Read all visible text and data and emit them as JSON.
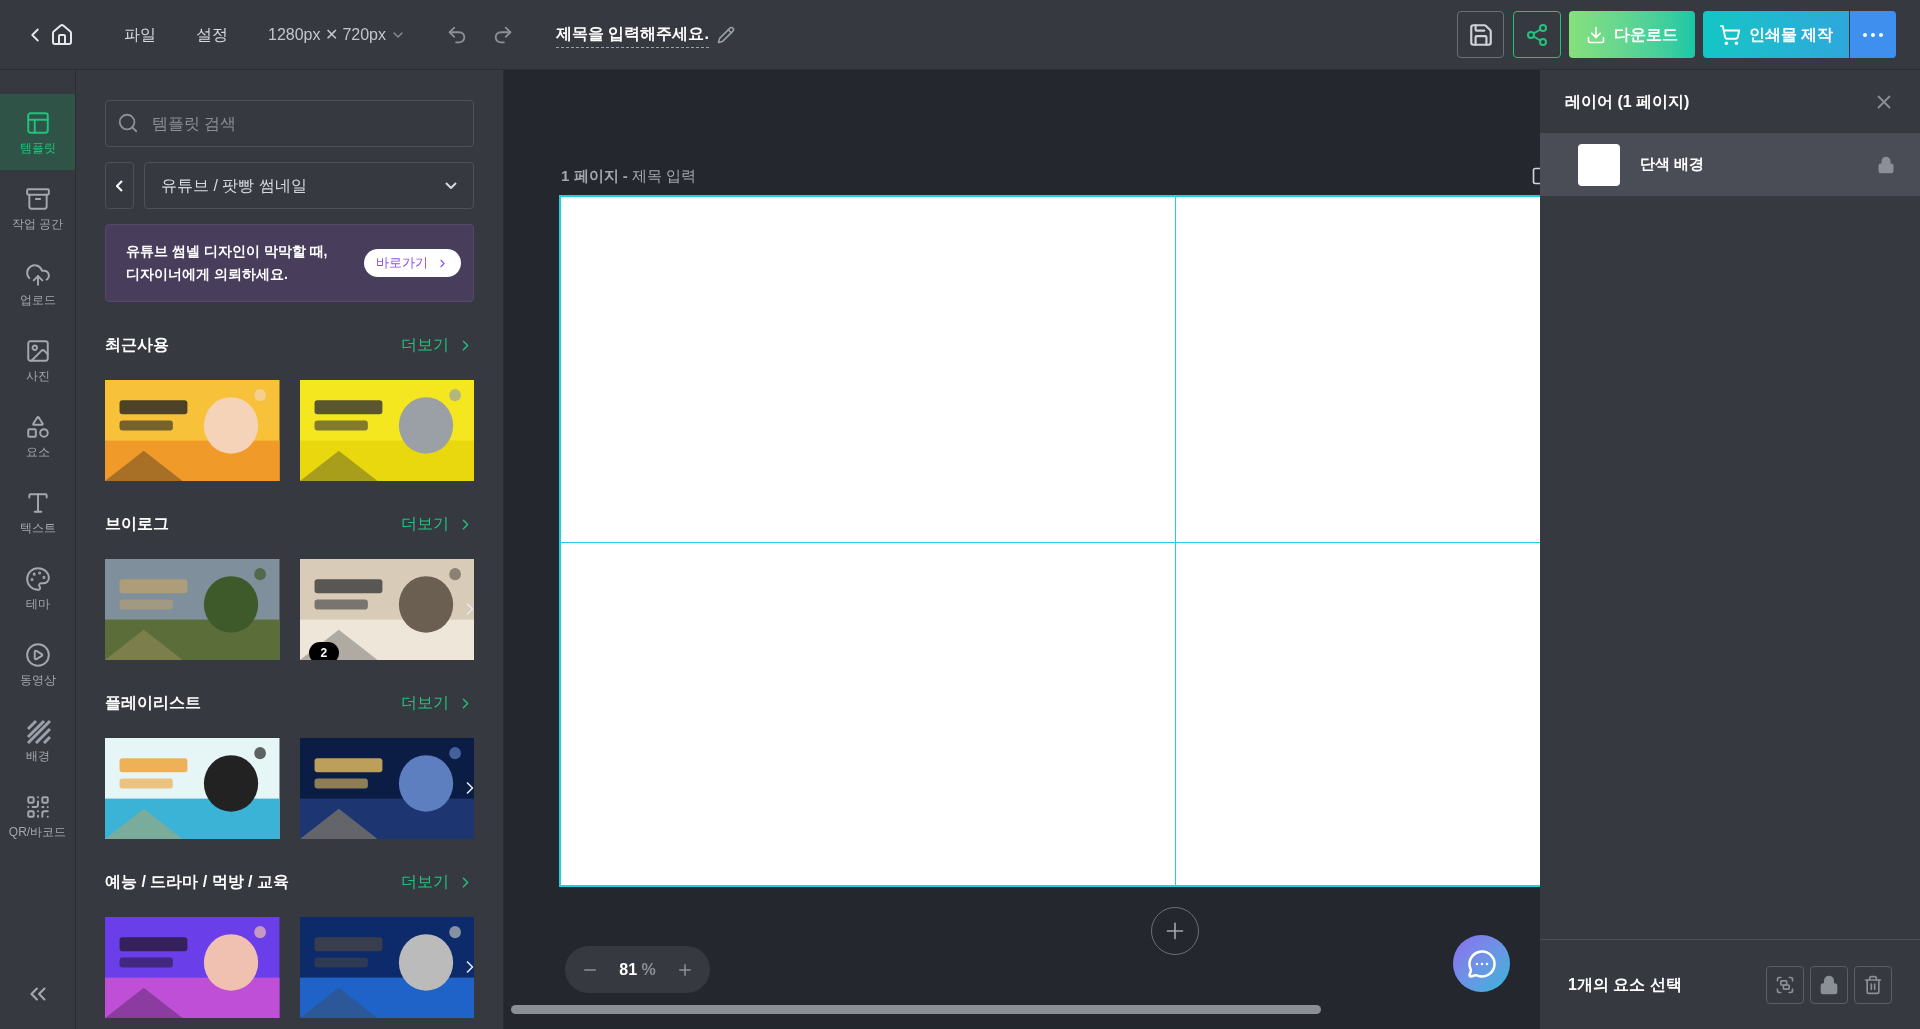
{
  "top_bar": {
    "menu": [
      "파일",
      "설정"
    ],
    "canvas_size": "1280px ✕ 720px",
    "title": "제목을 입력해주세요.",
    "download": "다운로드",
    "print": "인쇄물 제작"
  },
  "rail": {
    "items": [
      {
        "label": "템플릿",
        "selected": true
      },
      {
        "label": "작업 공간",
        "selected": false
      },
      {
        "label": "업로드",
        "selected": false
      },
      {
        "label": "사진",
        "selected": false
      },
      {
        "label": "요소",
        "selected": false
      },
      {
        "label": "텍스트",
        "selected": false
      },
      {
        "label": "테마",
        "selected": false
      },
      {
        "label": "동영상",
        "selected": false
      },
      {
        "label": "배경",
        "selected": false
      },
      {
        "label": "QR/바코드",
        "selected": false
      }
    ]
  },
  "panel": {
    "search": {
      "placeholder": "템플릿 검색"
    },
    "category": "유튜브 / 팟빵 썸네일",
    "banner": {
      "lines": [
        "유튜브 썸넬 디자인이 막막할 때,",
        "디자이너에게 의뢰하세요."
      ],
      "button": "바로가기"
    },
    "sections": [
      {
        "title": "최근사용",
        "more": "더보기",
        "has_next": false,
        "thumbs": [
          {
            "kind": "picture"
          },
          {
            "kind": "picture"
          }
        ]
      },
      {
        "title": "브이로그",
        "more": "더보기",
        "has_next": true,
        "thumbs": [
          {
            "kind": "picture"
          },
          {
            "kind": "picture",
            "badge": "2"
          }
        ]
      },
      {
        "title": "플레이리스트",
        "more": "더보기",
        "has_next": true,
        "thumbs": [
          {
            "kind": "picture"
          },
          {
            "kind": "picture"
          }
        ]
      },
      {
        "title": "예능 / 드라마 / 먹방 / 교육",
        "more": "더보기",
        "has_next": true,
        "thumbs": [
          {
            "kind": "picture"
          },
          {
            "kind": "picture"
          }
        ]
      }
    ]
  },
  "canvas": {
    "page_label": "1 페이지 -",
    "page_title": "제목 입력",
    "zoom": "81",
    "zoom_unit": "%"
  },
  "layers": {
    "title": "레이어 (1 페이지)",
    "items": [
      {
        "name": "단색 배경",
        "selected": true,
        "locked": true
      }
    ],
    "footer": "1개의 요소 선택"
  }
}
